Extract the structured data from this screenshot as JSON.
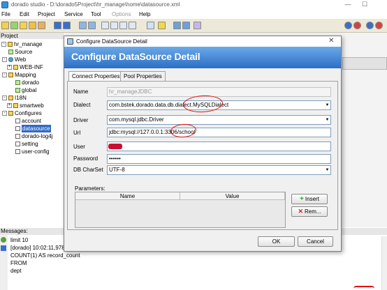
{
  "app": {
    "title": "dorado studio - D:\\dorado5Project\\hr_manage\\home\\datasource.xml",
    "window_controls": [
      "—",
      "☐"
    ]
  },
  "menu": [
    "File",
    "Edit",
    "Project",
    "Service",
    "Tool",
    "Options",
    "Help"
  ],
  "project_panel": {
    "header": "Project",
    "tree": [
      {
        "label": "hr_manage",
        "indent": 0,
        "icon": "folder",
        "expander": "-"
      },
      {
        "label": "Source",
        "indent": 1,
        "icon": "package",
        "expander": ""
      },
      {
        "label": "Web",
        "indent": 1,
        "icon": "web",
        "expander": "-"
      },
      {
        "label": "WEB-INF",
        "indent": 2,
        "icon": "folder",
        "expander": "+"
      },
      {
        "label": "Mapping",
        "indent": 1,
        "icon": "folder",
        "expander": "-"
      },
      {
        "label": "dorado",
        "indent": 2,
        "icon": "package",
        "expander": ""
      },
      {
        "label": "global",
        "indent": 2,
        "icon": "package",
        "expander": ""
      },
      {
        "label": "I18N",
        "indent": 1,
        "icon": "folder",
        "expander": "-"
      },
      {
        "label": "smartweb",
        "indent": 2,
        "icon": "folder",
        "expander": "+"
      },
      {
        "label": "Configures",
        "indent": 1,
        "icon": "folder",
        "expander": "-"
      },
      {
        "label": "account",
        "indent": 2,
        "icon": "file",
        "expander": ""
      },
      {
        "label": "datasource",
        "indent": 2,
        "icon": "file",
        "expander": "",
        "selected": true
      },
      {
        "label": "dorado-log4j",
        "indent": 2,
        "icon": "file",
        "expander": ""
      },
      {
        "label": "setting",
        "indent": 2,
        "icon": "file",
        "expander": ""
      },
      {
        "label": "user-config",
        "indent": 2,
        "icon": "file",
        "expander": ""
      }
    ]
  },
  "messages": {
    "header": "Messages:",
    "lines": [
      "limit 10",
      "[dorado] 10:02:11,978 D",
      "COUNT(1) AS record_count",
      "FROM",
      "dept"
    ]
  },
  "dialog": {
    "window_title": "Configure DataSource Detail",
    "close_glyph": "✕",
    "heading": "Configure DataSource Detail",
    "tabs": [
      "Connect Properties",
      "Pool Properties"
    ],
    "active_tab": 0,
    "fields": {
      "name": {
        "label": "Name",
        "value": "hr_manageJDBC"
      },
      "dialect": {
        "label": "Dialect",
        "value": "com.bstek.dorado.data.db.dialect.MySQLDialect"
      },
      "driver": {
        "label": "Driver",
        "value": "com.mysql.jdbc.Driver"
      },
      "url": {
        "label": "Url",
        "value": "jdbc:mysql://127.0.0.1:3306/school"
      },
      "user": {
        "label": "User",
        "value": ""
      },
      "password": {
        "label": "Password",
        "value": "••••••"
      },
      "charset": {
        "label": "DB CharSet",
        "value": "UTF-8"
      }
    },
    "dropdown_glyph": "▼",
    "parameters": {
      "label": "Parameters:",
      "columns": [
        "Name",
        "Value"
      ]
    },
    "insert_button": "Insert",
    "remove_button": "Rem...",
    "ok_button": "OK",
    "cancel_button": "Cancel"
  },
  "colors": {
    "banner_top": "#6aa9e8",
    "banner_bottom": "#2c6fc5",
    "selection": "#316ac5",
    "annotation": "#e01010"
  }
}
